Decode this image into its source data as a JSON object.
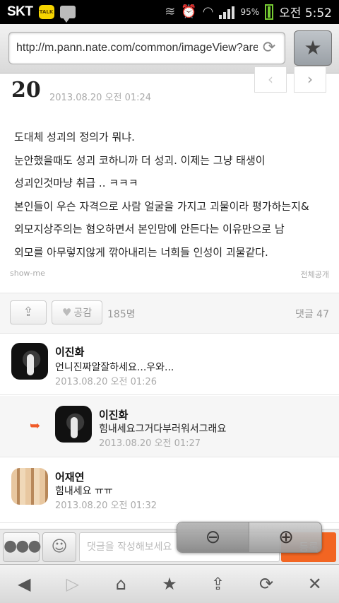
{
  "status_bar": {
    "carrier": "SKT",
    "talk_label": "TALK",
    "battery_percent": "95%",
    "time": "오전 5:52"
  },
  "browser": {
    "url": "http://m.pann.nate.com/common/imageView?area",
    "reload_icon": "reload-icon",
    "favorite_icon": "star-icon"
  },
  "post": {
    "number": "20",
    "date": "2013.08.20 오전 01:24",
    "prev_label": "‹",
    "next_label": "›",
    "body_lines": [
      "도대체 성괴의 정의가 뭐냐.",
      "눈안했을때도 성괴 코하니까 더 성괴. 이제는 그냥 태생이",
      "성괴인것마냥 취급 .. ㅋㅋㅋ",
      "본인들이 우슨 자격으로 사람 얼굴을 가지고 괴물이라 평가하는지&",
      "외모지상주의는 혐오하면서 본인맘에 안든다는 이유만으로 남",
      "외모를 아무렇지않게 깎아내리는 너희들 인성이 괴물같다."
    ],
    "author": "show-me",
    "visibility": "전체공개"
  },
  "actions": {
    "like_label": "공감",
    "like_count": "185명",
    "comment_count": "댓글 47"
  },
  "comments": [
    {
      "name": "이진화",
      "text": "언니진짜알잘하세요...우와...",
      "date": "2013.08.20 오전 01:26"
    },
    {
      "name": "이진화",
      "text": "힘내세요그거다부러워서그래요",
      "date": "2013.08.20 오전 01:27"
    },
    {
      "name": "어재연",
      "text": "힘내세요 ㅠㅠ",
      "date": "2013.08.20 오전 01:32"
    }
  ],
  "comment_input": {
    "placeholder": "댓글을 작성해보세요",
    "submit_label": "등록"
  },
  "colors": {
    "accent": "#f26522",
    "text": "#222222",
    "muted": "#aaaaaa"
  }
}
